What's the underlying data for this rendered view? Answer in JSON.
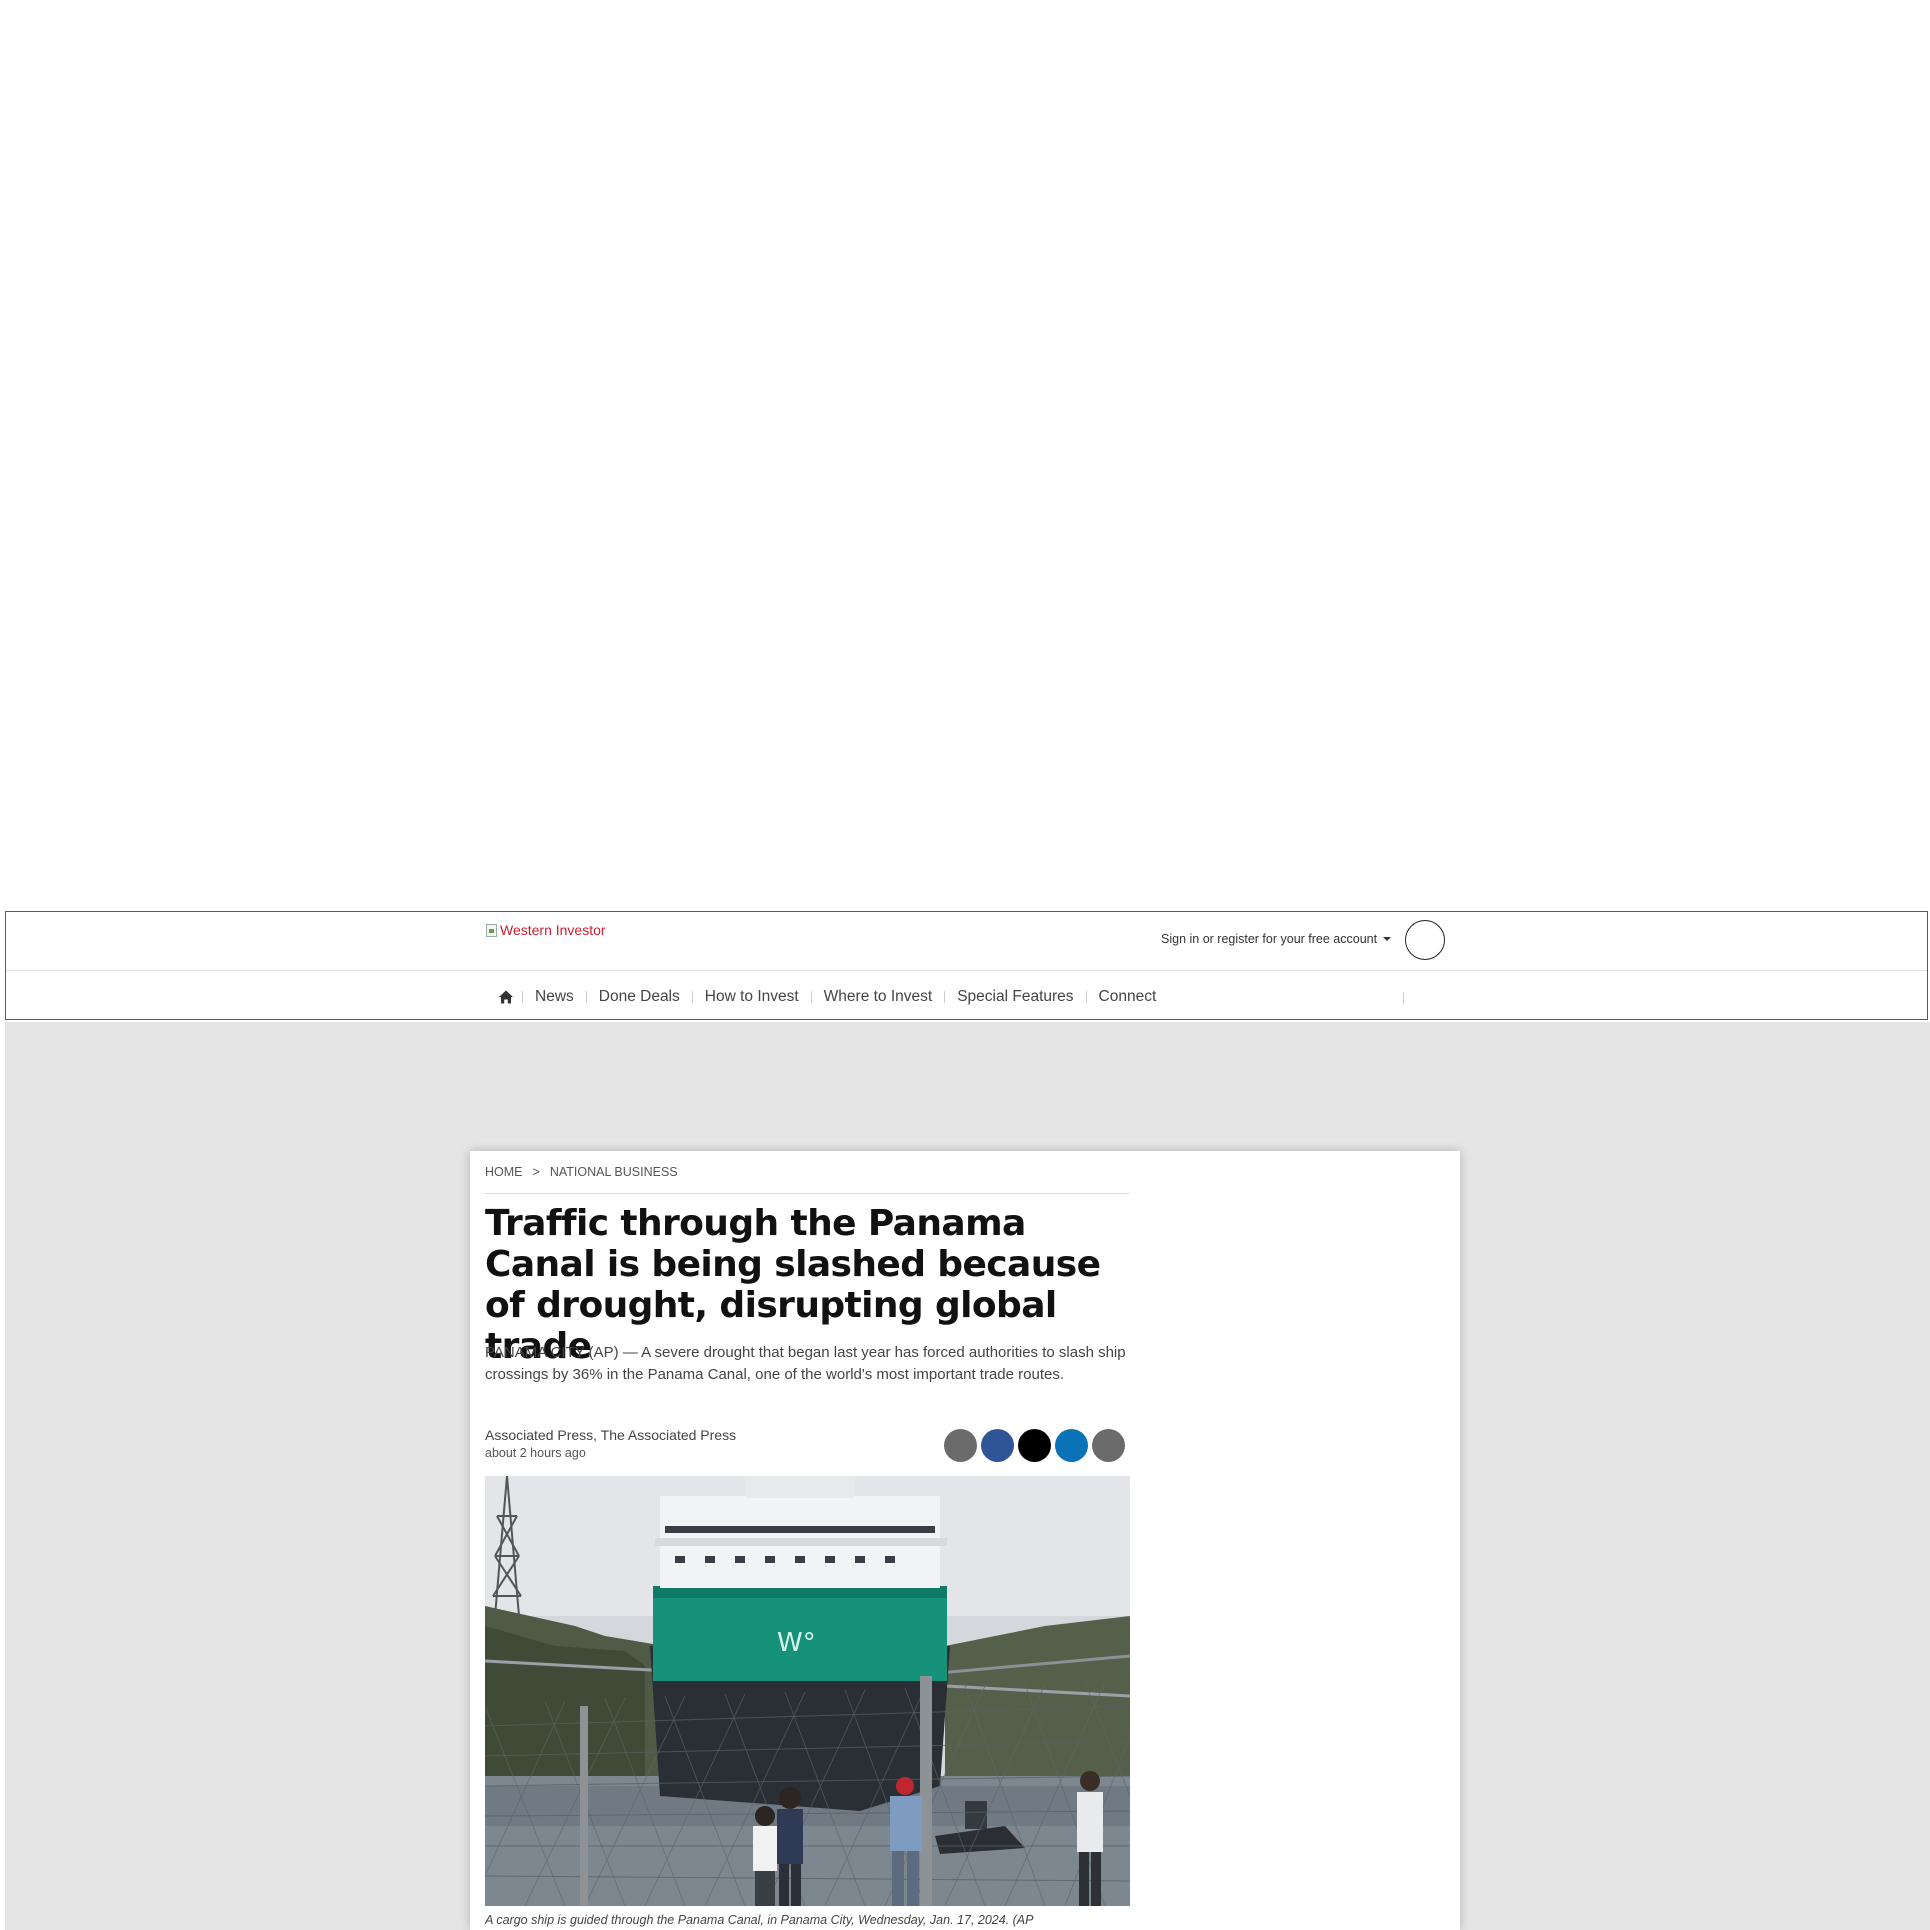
{
  "header": {
    "logo_alt": "Western Investor",
    "account_link": "Sign in or register for your free account"
  },
  "nav": {
    "items": [
      "News",
      "Done Deals",
      "How to Invest",
      "Where to Invest",
      "Special Features",
      "Connect"
    ]
  },
  "article": {
    "breadcrumb": [
      "HOME",
      ">",
      "NATIONAL BUSINESS"
    ],
    "headline": "Traffic through the Panama Canal is being slashed because of drought, disrupting global trade",
    "lede": "PANAMA CITY (AP) — A severe drought that began last year has forced authorities to slash ship crossings by 36% in the Panama Canal, one of the world's most important trade routes.",
    "byline": "Associated Press, The Associated Press",
    "timestamp": "about 2 hours ago",
    "share_buttons": [
      {
        "icon": "email-icon",
        "color": "#6b6b6b"
      },
      {
        "icon": "facebook-icon",
        "color": "#2f5596"
      },
      {
        "icon": "x-icon",
        "color": "#000000"
      },
      {
        "icon": "linkedin-icon",
        "color": "#0a72b5"
      },
      {
        "icon": "more-share-icon",
        "color": "#6b6b6b"
      }
    ],
    "caption": "A cargo ship is guided through the Panama Canal, in Panama City, Wednesday, Jan. 17, 2024. (AP"
  },
  "colors": {
    "brand_red": "#d9242c",
    "page_gray": "#e5e5e5"
  }
}
